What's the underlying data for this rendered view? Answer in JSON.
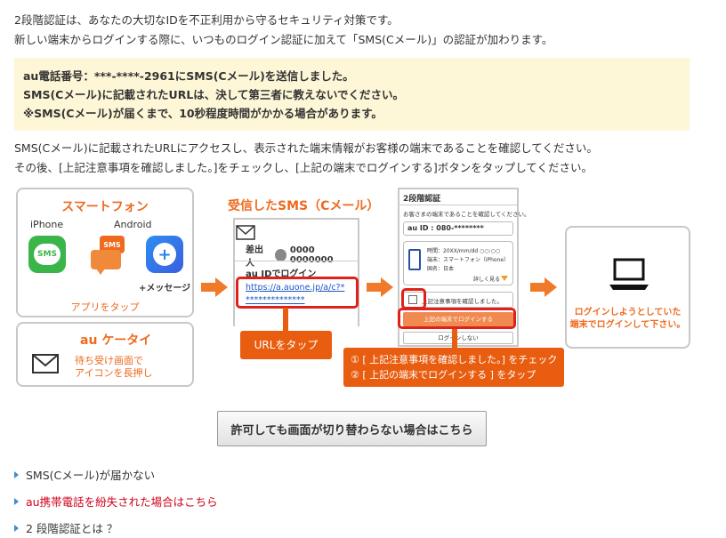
{
  "intro": {
    "line1": "2段階認証は、あなたの大切なIDを不正利用から守るセキュリティ対策です。",
    "line2": "新しい端末からログインする際に、いつものログイン認証に加えて「SMS(Cメール)」の認証が加わります。"
  },
  "notice": {
    "line1": "au電話番号：***-****-2961にSMS(Cメール)を送信しました。",
    "line2": "SMS(Cメール)に記載されたURLは、決して第三者に教えないでください。",
    "line3": "※SMS(Cメール)が届くまで、10秒程度時間がかかる場合があります。"
  },
  "description": {
    "line1": "SMS(Cメール)に記載されたURLにアクセスし、表示された端末情報がお客様の端末であることを確認してください。",
    "line2": "その後、[上記注意事項を確認しました。]をチェックし、[上記の端末でログインする]ボタンをタップしてください。"
  },
  "smartphone_box": {
    "title": "スマートフォン",
    "iphone_label": "iPhone",
    "android_label": "Android",
    "sms_icon_text": "SMS",
    "sms_bubble_text": "SMS",
    "message_app_label": "+メッセージ",
    "caption": "アプリをタップ"
  },
  "keitai_box": {
    "title": "au ケータイ",
    "caption_line1": "待ち受け画面で",
    "caption_line2": "アイコンを長押し"
  },
  "sms_panel": {
    "title": "受信したSMS（Cメール）",
    "sender_label": "差出人",
    "sender_number": "0000 0000000",
    "subject": "au IDでログイン",
    "url": "https://a.auone.jp/a/c?*",
    "url_tail": "**************",
    "tap_label": "URLをタップ"
  },
  "auth_panel": {
    "header": "2段階認証",
    "confirm_text": "お客さまの端末であることを確認してください。",
    "au_id": "au ID : 080-********",
    "time_line": "時間：20XX/mm/dd ○○:○○",
    "device_line": "端末：スマートフォン（iPhone）",
    "country_line": "国名：日本",
    "more_link": "詳しく見る",
    "checkbox_label": "上記注意事項を確認しました。",
    "login_button": "上記の端末でログインする",
    "no_login_button": "ログインしない",
    "step1": "① [ 上記注意事項を確認しました。] をチェック",
    "step2": "② [ 上記の端末でログインする ] をタップ"
  },
  "result_box": {
    "line1": "ログインしようとしていた",
    "line2": "端末でログインして下さい。"
  },
  "fallback_button": "許可しても画面が切り替わらない場合はこちら",
  "links": [
    {
      "label": "SMS(Cメール)が届かない",
      "color": "#333333"
    },
    {
      "label": "au携帯電話を紛失された場合はこちら",
      "color": "#d0021b"
    },
    {
      "label": "2 段階認証とは ？",
      "color": "#333333"
    }
  ],
  "colors": {
    "accent": "#ee6a1f",
    "notice_bg": "#fdf6d7",
    "red_frame": "#e0201b"
  }
}
